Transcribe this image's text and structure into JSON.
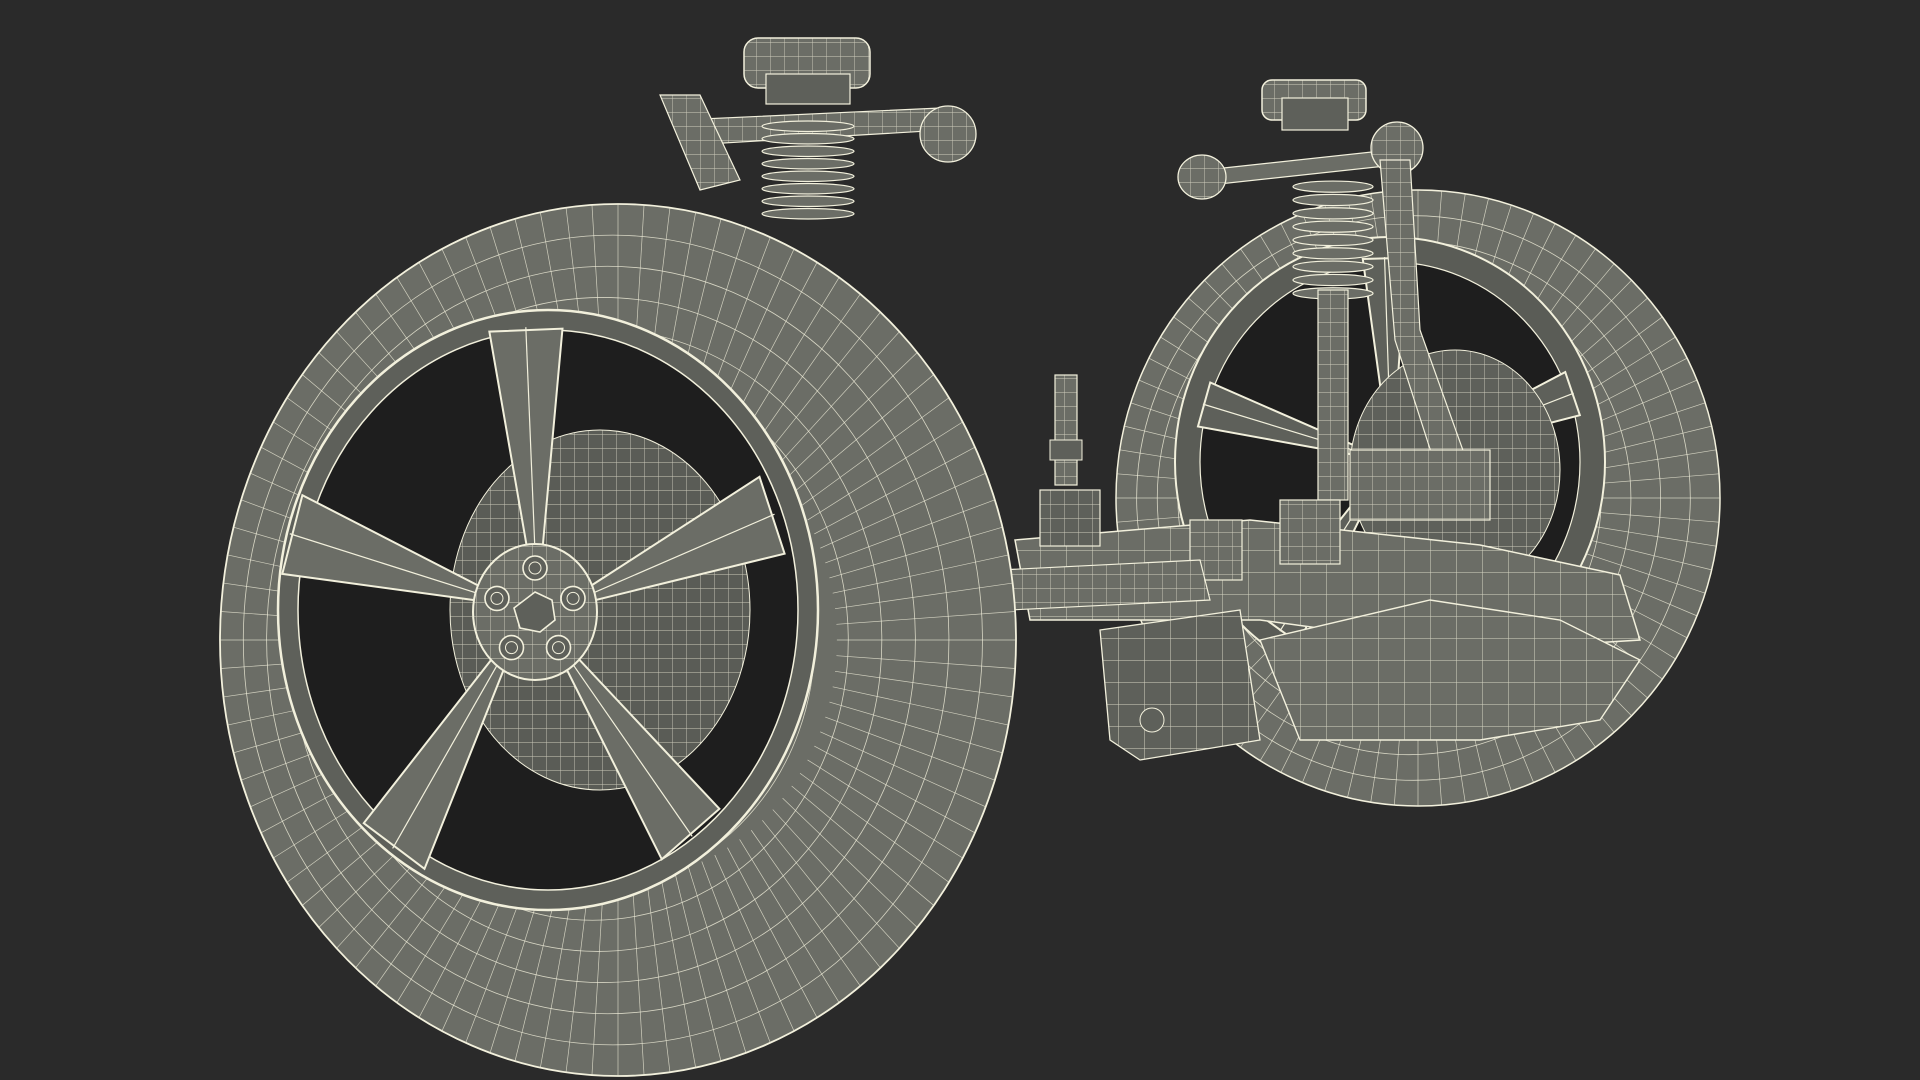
{
  "scene": {
    "subject": "front-suspension-wireframe-render",
    "background_color": "#2a2a2a",
    "mesh_fill_color": "#6b6d66",
    "mesh_shade_color": "#4a4c46",
    "mesh_line_color": "#f2f0dc",
    "hole_color": "#1e1e1e"
  }
}
